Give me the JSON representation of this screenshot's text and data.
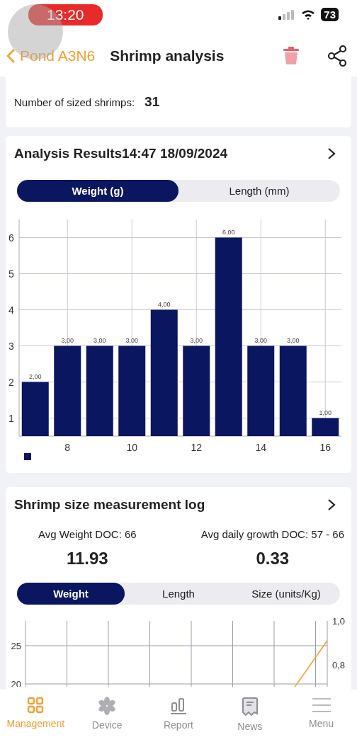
{
  "status_bar": {
    "time": "13:20",
    "battery": "73"
  },
  "nav": {
    "back_label": "Pond A3N6",
    "title": "Shrimp analysis"
  },
  "summary": {
    "label": "Number of sized shrimps:",
    "value": "31"
  },
  "analysis": {
    "title": "Analysis Results14:47 18/09/2024",
    "tabs": [
      {
        "label": "Weight (g)",
        "selected": true
      },
      {
        "label": "Length (mm)",
        "selected": false
      }
    ],
    "chart_data": {
      "type": "bar",
      "x": [
        7,
        8,
        9,
        10,
        11,
        12,
        13,
        14,
        15,
        16
      ],
      "grid": true,
      "series": [
        {
          "color": "#0b1660",
          "values": [
            2,
            3,
            3,
            3,
            4,
            3,
            6,
            3,
            3,
            1
          ]
        }
      ],
      "value_labels": [
        "2,00",
        "3,00",
        "3,00",
        "3,00",
        "4,00",
        "3,00",
        "6,00",
        "3,00",
        "3,00",
        "1,00"
      ],
      "xticks": [
        8,
        10,
        12,
        14,
        16
      ],
      "yticks": [
        1,
        2,
        3,
        4,
        5,
        6
      ],
      "xlim": [
        6.5,
        16.5
      ],
      "ylim": [
        0.5,
        6.5
      ]
    }
  },
  "log": {
    "title": "Shrimp size measurement log",
    "stats": [
      {
        "label": "Avg Weight DOC: 66",
        "value": "11.93"
      },
      {
        "label": "Avg daily growth DOC: 57 - 66",
        "value": "0.33"
      }
    ],
    "tabs": [
      {
        "label": "Weight",
        "selected": true
      },
      {
        "label": "Length",
        "selected": false
      },
      {
        "label": "Size (units/Kg)",
        "selected": false
      }
    ],
    "chart": {
      "left_ticks": [
        "25",
        "20"
      ],
      "right_ticks": [
        "1,0",
        "0,8"
      ]
    }
  },
  "tab_bar": [
    {
      "label": "Management",
      "selected": true
    },
    {
      "label": "Device",
      "selected": false
    },
    {
      "label": "Report",
      "selected": false
    },
    {
      "label": "News",
      "selected": false
    },
    {
      "label": "Menu",
      "selected": false
    }
  ]
}
